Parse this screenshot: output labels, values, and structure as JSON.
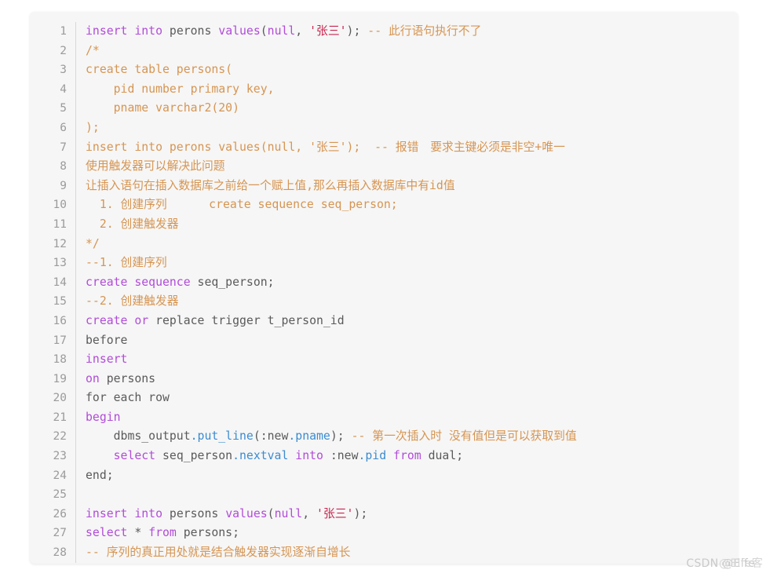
{
  "watermark": {
    "text": "CSDN @Elfe",
    "overlay": "@Elfe客"
  },
  "code_block": {
    "language": "sql",
    "colors": {
      "background": "#f6f6f6",
      "keyword": "#b14bd8",
      "identifier": "#5a5a5a",
      "string": "#c7254e",
      "comment": "#d69552",
      "function": "#3b8cd0",
      "gutter": "#9b9b9b"
    },
    "lines": [
      {
        "n": "1",
        "tokens": [
          {
            "t": "kw",
            "v": "insert into"
          },
          {
            "t": "ident",
            "v": " perons "
          },
          {
            "t": "kw",
            "v": "values"
          },
          {
            "t": "punc",
            "v": "("
          },
          {
            "t": "kw",
            "v": "null"
          },
          {
            "t": "punc",
            "v": ", "
          },
          {
            "t": "str",
            "v": "'张三'"
          },
          {
            "t": "punc",
            "v": "); "
          },
          {
            "t": "cmt",
            "v": "-- 此行语句执行不了"
          }
        ]
      },
      {
        "n": "2",
        "tokens": [
          {
            "t": "cmt",
            "v": "/*"
          }
        ]
      },
      {
        "n": "3",
        "tokens": [
          {
            "t": "cmt",
            "v": "create table persons("
          }
        ]
      },
      {
        "n": "4",
        "tokens": [
          {
            "t": "cmt",
            "v": "    pid number primary key,"
          }
        ]
      },
      {
        "n": "5",
        "tokens": [
          {
            "t": "cmt",
            "v": "    pname varchar2(20)"
          }
        ]
      },
      {
        "n": "6",
        "tokens": [
          {
            "t": "cmt",
            "v": ");"
          }
        ]
      },
      {
        "n": "7",
        "tokens": [
          {
            "t": "cmt",
            "v": "insert into perons values(null, '张三');  -- 报错　要求主键必须是非空+唯一"
          }
        ]
      },
      {
        "n": "8",
        "tokens": [
          {
            "t": "cmt",
            "v": "使用触发器可以解决此问题"
          }
        ]
      },
      {
        "n": "9",
        "tokens": [
          {
            "t": "cmt",
            "v": "让插入语句在插入数据库之前给一个赋上值,那么再插入数据库中有id值"
          }
        ]
      },
      {
        "n": "10",
        "tokens": [
          {
            "t": "cmt",
            "v": "  1. 创建序列      create sequence seq_person;"
          }
        ]
      },
      {
        "n": "11",
        "tokens": [
          {
            "t": "cmt",
            "v": "  2. 创建触发器"
          }
        ]
      },
      {
        "n": "12",
        "tokens": [
          {
            "t": "cmt",
            "v": "*/"
          }
        ]
      },
      {
        "n": "13",
        "tokens": [
          {
            "t": "cmt",
            "v": "--1. 创建序列"
          }
        ]
      },
      {
        "n": "14",
        "tokens": [
          {
            "t": "kw",
            "v": "create sequence"
          },
          {
            "t": "ident",
            "v": " seq_person"
          },
          {
            "t": "punc",
            "v": ";"
          }
        ]
      },
      {
        "n": "15",
        "tokens": [
          {
            "t": "cmt",
            "v": "--2. 创建触发器"
          }
        ]
      },
      {
        "n": "16",
        "tokens": [
          {
            "t": "kw",
            "v": "create or"
          },
          {
            "t": "ident",
            "v": " replace trigger t_person_id"
          }
        ]
      },
      {
        "n": "17",
        "tokens": [
          {
            "t": "ident",
            "v": "before"
          }
        ]
      },
      {
        "n": "18",
        "tokens": [
          {
            "t": "kw",
            "v": "insert"
          }
        ]
      },
      {
        "n": "19",
        "tokens": [
          {
            "t": "kw",
            "v": "on"
          },
          {
            "t": "ident",
            "v": " persons"
          }
        ]
      },
      {
        "n": "20",
        "tokens": [
          {
            "t": "ident",
            "v": "for each row"
          }
        ]
      },
      {
        "n": "21",
        "tokens": [
          {
            "t": "kw",
            "v": "begin"
          }
        ]
      },
      {
        "n": "22",
        "tokens": [
          {
            "t": "ident",
            "v": "    dbms_output"
          },
          {
            "t": "fn",
            "v": ".put_line"
          },
          {
            "t": "ident",
            "v": "(:new"
          },
          {
            "t": "fn",
            "v": ".pname"
          },
          {
            "t": "punc",
            "v": "); "
          },
          {
            "t": "cmt",
            "v": "-- 第一次插入时 没有值但是可以获取到值"
          }
        ]
      },
      {
        "n": "23",
        "tokens": [
          {
            "t": "kw",
            "v": "    select"
          },
          {
            "t": "ident",
            "v": " seq_person"
          },
          {
            "t": "fn",
            "v": ".nextval"
          },
          {
            "t": "punc",
            "v": " "
          },
          {
            "t": "kw",
            "v": "into"
          },
          {
            "t": "ident",
            "v": " :new"
          },
          {
            "t": "fn",
            "v": ".pid"
          },
          {
            "t": "punc",
            "v": " "
          },
          {
            "t": "kw",
            "v": "from"
          },
          {
            "t": "ident",
            "v": " dual"
          },
          {
            "t": "punc",
            "v": ";"
          }
        ]
      },
      {
        "n": "24",
        "tokens": [
          {
            "t": "ident",
            "v": "end;"
          }
        ]
      },
      {
        "n": "25",
        "tokens": [
          {
            "t": "ident",
            "v": ""
          }
        ]
      },
      {
        "n": "26",
        "tokens": [
          {
            "t": "kw",
            "v": "insert into"
          },
          {
            "t": "ident",
            "v": " persons "
          },
          {
            "t": "kw",
            "v": "values"
          },
          {
            "t": "punc",
            "v": "("
          },
          {
            "t": "kw",
            "v": "null"
          },
          {
            "t": "punc",
            "v": ", "
          },
          {
            "t": "str",
            "v": "'张三'"
          },
          {
            "t": "punc",
            "v": ");"
          }
        ]
      },
      {
        "n": "27",
        "tokens": [
          {
            "t": "kw",
            "v": "select"
          },
          {
            "t": "ident",
            "v": " * "
          },
          {
            "t": "kw",
            "v": "from"
          },
          {
            "t": "ident",
            "v": " persons"
          },
          {
            "t": "punc",
            "v": ";"
          }
        ]
      },
      {
        "n": "28",
        "tokens": [
          {
            "t": "cmt",
            "v": "-- 序列的真正用处就是结合触发器实现逐渐自增长"
          }
        ]
      }
    ]
  }
}
